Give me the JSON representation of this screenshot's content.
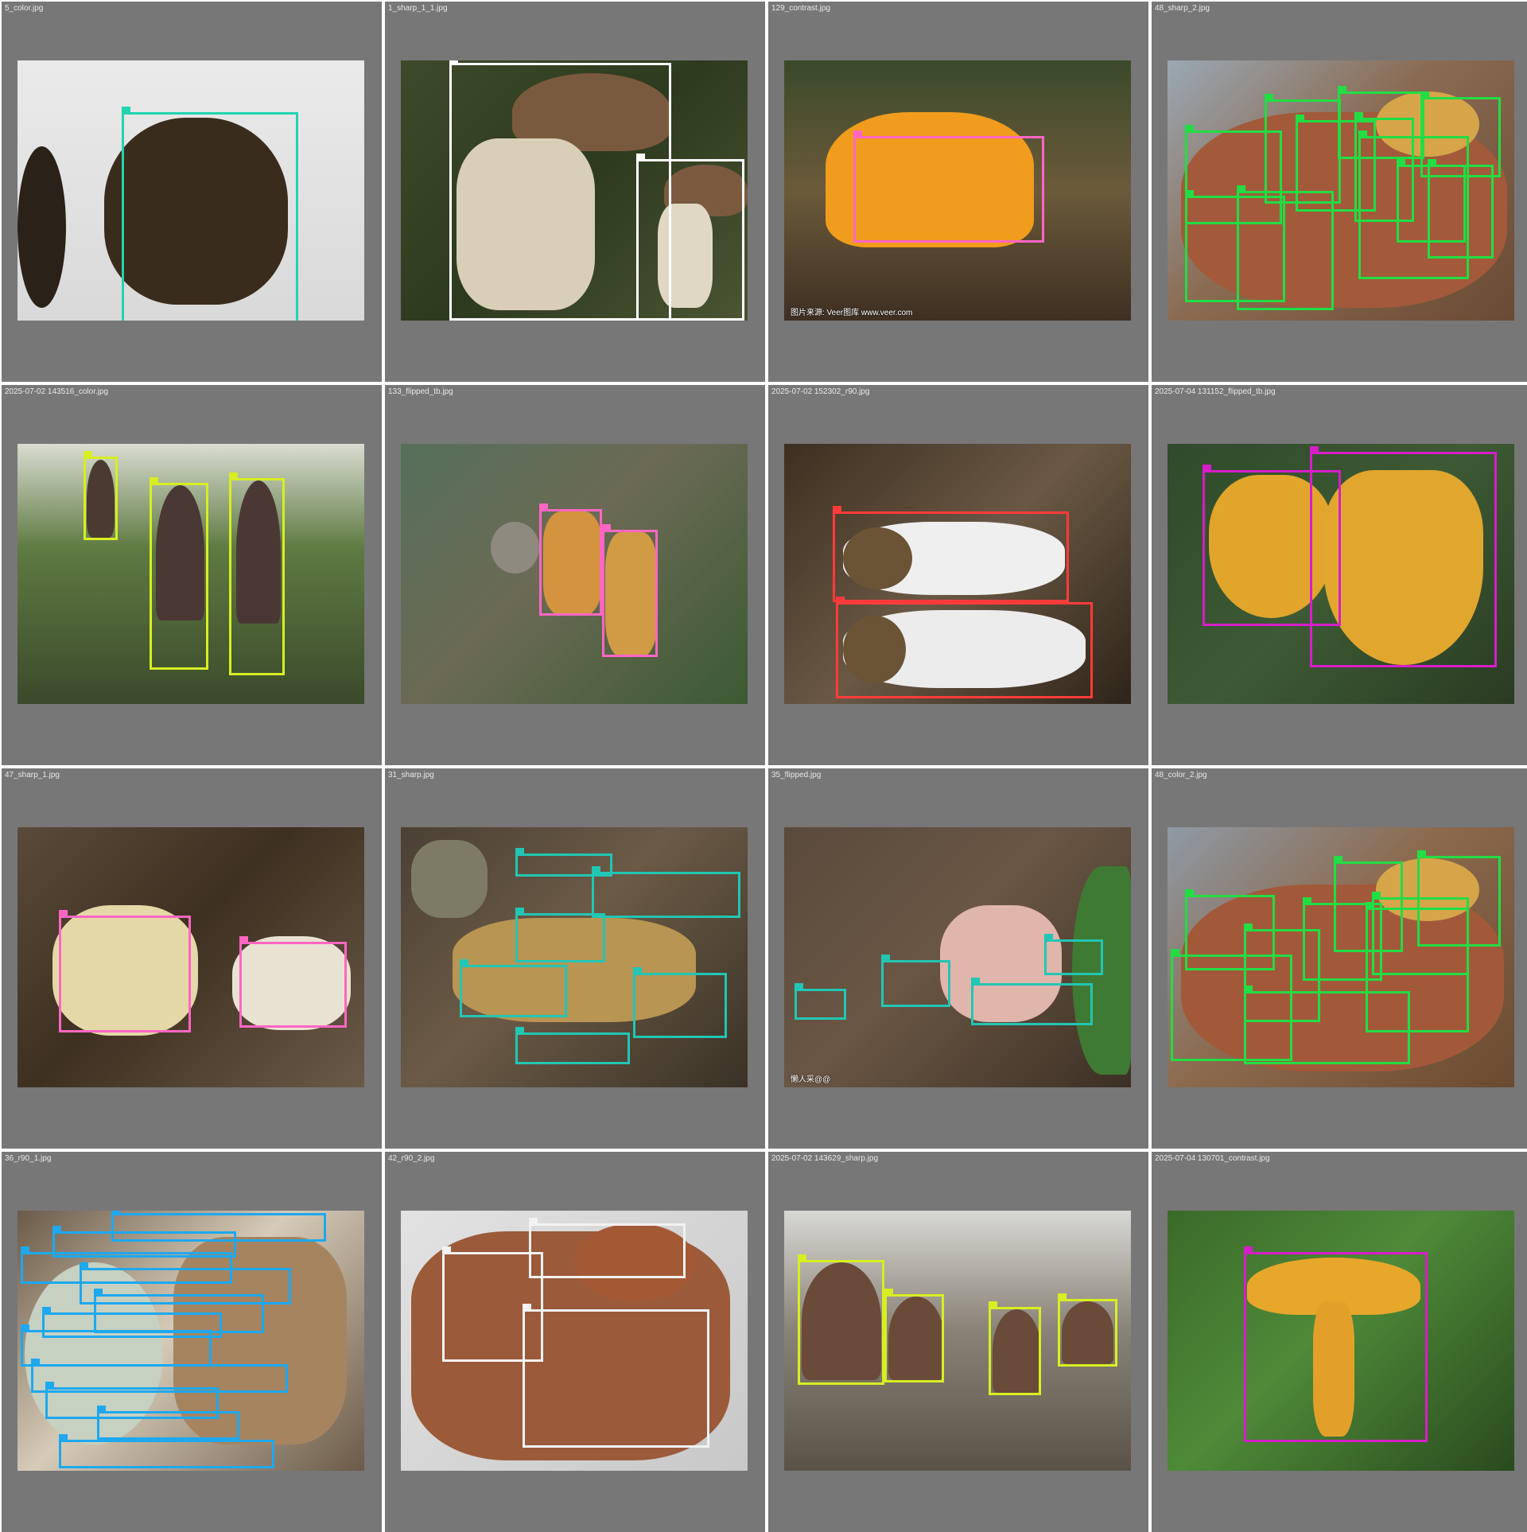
{
  "grid": {
    "cells": [
      {
        "filename": "5_color.jpg",
        "photo_bg": "linear-gradient(180deg,#eaeaea,#d9d9d9)",
        "box_color": "#22d3b0",
        "boxes": [
          [
            30,
            20,
            81,
            101
          ]
        ],
        "blobs": [
          {
            "l": 0,
            "t": 33,
            "w": 14,
            "h": 62,
            "c": "#2a2218",
            "r": "50%"
          },
          {
            "l": 25,
            "t": 22,
            "w": 53,
            "h": 72,
            "c": "#3a2c1c",
            "r": "45% 45% 40% 40%"
          }
        ]
      },
      {
        "filename": "1_sharp_1_1.jpg",
        "photo_bg": "linear-gradient(135deg,#3d4a2a,#2d3a1e 50%,#4b5533)",
        "box_color": "#ffffff",
        "boxes": [
          [
            14,
            1,
            78,
            100
          ],
          [
            68,
            38,
            99,
            100
          ]
        ],
        "blobs": [
          {
            "l": 32,
            "t": 5,
            "w": 46,
            "h": 30,
            "c": "#7a5a3e",
            "r": "50% 50% 30% 30%"
          },
          {
            "l": 16,
            "t": 30,
            "w": 40,
            "h": 66,
            "c": "#d8cfb6",
            "r": "30%"
          },
          {
            "l": 76,
            "t": 40,
            "w": 24,
            "h": 20,
            "c": "#7b5a40",
            "r": "50% 50% 30% 30%"
          },
          {
            "l": 74,
            "t": 55,
            "w": 16,
            "h": 40,
            "c": "#e0d8c4",
            "r": "30%"
          }
        ]
      },
      {
        "filename": "129_contrast.jpg",
        "photo_bg": "linear-gradient(180deg,#3a4a2a,#6b5a3a 50%,#3e2f22)",
        "box_color": "#ff66c4",
        "boxes": [
          [
            20,
            29,
            75,
            70
          ]
        ],
        "blobs": [
          {
            "l": 12,
            "t": 20,
            "w": 60,
            "h": 52,
            "c": "#f19c1d",
            "r": "40% 40% 20% 20%"
          }
        ],
        "watermark": "图片来源: Veer图库 www.veer.com"
      },
      {
        "filename": "48_sharp_2.jpg",
        "photo_bg": "linear-gradient(135deg,#9aa8b4,#8a6a50 45%,#6a4a34)",
        "box_color": "#22dd44",
        "boxes": [
          [
            5,
            27,
            33,
            63
          ],
          [
            28,
            15,
            50,
            55
          ],
          [
            49,
            12,
            74,
            38
          ],
          [
            73,
            14,
            96,
            45
          ],
          [
            37,
            23,
            60,
            58
          ],
          [
            20,
            50,
            48,
            96
          ],
          [
            54,
            22,
            71,
            62
          ],
          [
            55,
            29,
            87,
            84
          ],
          [
            75,
            40,
            94,
            76
          ],
          [
            5,
            52,
            34,
            93
          ],
          [
            66,
            40,
            86,
            70
          ]
        ],
        "blobs": [
          {
            "l": 4,
            "t": 20,
            "w": 94,
            "h": 75,
            "c": "#a25a3a",
            "r": "40%"
          },
          {
            "l": 60,
            "t": 12,
            "w": 30,
            "h": 25,
            "c": "#d6a54a",
            "r": "50%"
          }
        ]
      },
      {
        "filename": "2025-07-02 143516_color.jpg",
        "photo_bg": "linear-gradient(180deg,#d9ddd2,#5f7a42 40%,#3b4a2b)",
        "box_color": "#d7ee22",
        "boxes": [
          [
            19,
            5,
            29,
            37
          ],
          [
            38,
            15,
            55,
            87
          ],
          [
            61,
            13,
            77,
            89
          ]
        ],
        "blobs": [
          {
            "l": 20,
            "t": 6,
            "w": 8,
            "h": 30,
            "c": "#4a3a30",
            "r": "50% 50% 20% 20%"
          },
          {
            "l": 40,
            "t": 16,
            "w": 14,
            "h": 52,
            "c": "#4a3834",
            "r": "50% 50% 10% 10%"
          },
          {
            "l": 63,
            "t": 14,
            "w": 13,
            "h": 55,
            "c": "#4b3835",
            "r": "50% 50% 10% 10%"
          }
        ]
      },
      {
        "filename": "133_flipped_tb.jpg",
        "photo_bg": "linear-gradient(135deg,#56705a,#6b6a55 45%,#3b5a32)",
        "box_color": "#ff66c4",
        "boxes": [
          [
            40,
            25,
            58,
            66
          ],
          [
            58,
            33,
            74,
            82
          ]
        ],
        "blobs": [
          {
            "l": 41,
            "t": 26,
            "w": 17,
            "h": 40,
            "c": "#d3933f",
            "r": "30%"
          },
          {
            "l": 59,
            "t": 34,
            "w": 15,
            "h": 48,
            "c": "#d19a44",
            "r": "30%"
          },
          {
            "l": 26,
            "t": 30,
            "w": 14,
            "h": 20,
            "c": "#8f8a80",
            "r": "50%"
          }
        ]
      },
      {
        "filename": "2025-07-02 152302_r90.jpg",
        "photo_bg": "linear-gradient(135deg,#3d2f20,#6a5844 50%,#2e2418)",
        "box_color": "#ff3b3b",
        "boxes": [
          [
            14,
            26,
            82,
            61
          ],
          [
            15,
            61,
            89,
            98
          ]
        ],
        "blobs": [
          {
            "l": 17,
            "t": 30,
            "w": 64,
            "h": 28,
            "c": "#efefef",
            "r": "40%"
          },
          {
            "l": 17,
            "t": 64,
            "w": 70,
            "h": 30,
            "c": "#ececec",
            "r": "40%"
          },
          {
            "l": 17,
            "t": 32,
            "w": 20,
            "h": 24,
            "c": "#6b5335",
            "r": "50%"
          },
          {
            "l": 17,
            "t": 66,
            "w": 18,
            "h": 26,
            "c": "#6b5335",
            "r": "50%"
          }
        ]
      },
      {
        "filename": "2025-07-04 131152_flipped_tb.jpg",
        "photo_bg": "linear-gradient(135deg,#2e4a2a,#3d5a34 50%,#2a3b22)",
        "box_color": "#d61ec8",
        "boxes": [
          [
            10,
            10,
            50,
            70
          ],
          [
            41,
            3,
            95,
            86
          ]
        ],
        "blobs": [
          {
            "l": 12,
            "t": 12,
            "w": 36,
            "h": 55,
            "c": "#e2a52c",
            "r": "40% 40% 50% 50%"
          },
          {
            "l": 45,
            "t": 10,
            "w": 46,
            "h": 75,
            "c": "#e0a62e",
            "r": "35% 35% 55% 55%"
          }
        ]
      },
      {
        "filename": "47_sharp_1.jpg",
        "photo_bg": "linear-gradient(135deg,#5a4a3a,#3e3020 45%,#6a5a48)",
        "box_color": "#ff66c4",
        "boxes": [
          [
            12,
            34,
            50,
            79
          ],
          [
            64,
            44,
            95,
            77
          ]
        ],
        "blobs": [
          {
            "l": 10,
            "t": 30,
            "w": 42,
            "h": 50,
            "c": "#e4d8a8",
            "r": "40%"
          },
          {
            "l": 62,
            "t": 42,
            "w": 34,
            "h": 36,
            "c": "#e8e2d2",
            "r": "40%"
          }
        ]
      },
      {
        "filename": "31_sharp.jpg",
        "photo_bg": "linear-gradient(135deg,#4a4034,#6b5a46 45%,#3a3226)",
        "box_color": "#22c6b4",
        "boxes": [
          [
            33,
            10,
            61,
            19
          ],
          [
            55,
            17,
            98,
            35
          ],
          [
            33,
            33,
            59,
            52
          ],
          [
            17,
            53,
            48,
            73
          ],
          [
            67,
            56,
            94,
            81
          ],
          [
            33,
            79,
            66,
            91
          ]
        ],
        "blobs": [
          {
            "l": 15,
            "t": 35,
            "w": 70,
            "h": 40,
            "c": "#b89552",
            "r": "35%"
          },
          {
            "l": 3,
            "t": 5,
            "w": 22,
            "h": 30,
            "c": "#7d7a66",
            "r": "40%"
          }
        ]
      },
      {
        "filename": "35_flipped.jpg",
        "photo_bg": "linear-gradient(135deg,#5a4a3c,#6a5644 45%,#3c3024)",
        "box_color": "#22c6b4",
        "boxes": [
          [
            3,
            62,
            18,
            74
          ],
          [
            28,
            51,
            48,
            69
          ],
          [
            54,
            60,
            89,
            76
          ],
          [
            75,
            43,
            92,
            57
          ]
        ],
        "blobs": [
          {
            "l": 45,
            "t": 30,
            "w": 35,
            "h": 45,
            "c": "#e0b5ac",
            "r": "40%"
          },
          {
            "l": 83,
            "t": 15,
            "w": 17,
            "h": 80,
            "c": "#3f7a34",
            "r": "50% 10% 10% 50%"
          }
        ],
        "watermark": "懒人采@@"
      },
      {
        "filename": "48_color_2.jpg",
        "photo_bg": "linear-gradient(135deg,#8e9aa6,#8c6a4e 45%,#6a4a30)",
        "box_color": "#22dd44",
        "boxes": [
          [
            5,
            26,
            31,
            55
          ],
          [
            72,
            11,
            96,
            46
          ],
          [
            48,
            13,
            68,
            48
          ],
          [
            39,
            29,
            62,
            59
          ],
          [
            59,
            27,
            87,
            57
          ],
          [
            22,
            39,
            44,
            75
          ],
          [
            1,
            49,
            36,
            90
          ],
          [
            57,
            31,
            87,
            79
          ],
          [
            22,
            63,
            70,
            91
          ]
        ],
        "blobs": [
          {
            "l": 4,
            "t": 22,
            "w": 93,
            "h": 72,
            "c": "#a2593a",
            "r": "40%"
          },
          {
            "l": 60,
            "t": 12,
            "w": 30,
            "h": 24,
            "c": "#d6a54a",
            "r": "50%"
          }
        ]
      },
      {
        "filename": "36_r90_1.jpg",
        "photo_bg": "linear-gradient(135deg,#6b5a48,#d6cbb8 45%,#6b5a48)",
        "box_color": "#1ea8ee",
        "boxes": [
          [
            27,
            1,
            89,
            12
          ],
          [
            10,
            8,
            63,
            18
          ],
          [
            1,
            16,
            62,
            28
          ],
          [
            18,
            22,
            79,
            36
          ],
          [
            22,
            32,
            71,
            47
          ],
          [
            7,
            39,
            59,
            49
          ],
          [
            1,
            46,
            56,
            60
          ],
          [
            4,
            59,
            78,
            70
          ],
          [
            8,
            68,
            58,
            80
          ],
          [
            23,
            77,
            64,
            88
          ],
          [
            12,
            88,
            74,
            99
          ]
        ],
        "blobs": [
          {
            "l": 2,
            "t": 20,
            "w": 40,
            "h": 70,
            "c": "#c7d1c2",
            "r": "50%"
          },
          {
            "l": 45,
            "t": 10,
            "w": 50,
            "h": 80,
            "c": "#a68460",
            "r": "30%"
          }
        ],
        "watermark": ""
      },
      {
        "filename": "42_r90_2.jpg",
        "photo_bg": "linear-gradient(135deg,#e2e2e2,#c8c8c8)",
        "box_color": "#f2f2f2",
        "boxes": [
          [
            37,
            5,
            82,
            26
          ],
          [
            12,
            16,
            41,
            58
          ],
          [
            35,
            38,
            89,
            91
          ]
        ],
        "blobs": [
          {
            "l": 3,
            "t": 8,
            "w": 92,
            "h": 88,
            "c": "#9b5a3a",
            "r": "30%"
          },
          {
            "l": 50,
            "t": 5,
            "w": 35,
            "h": 30,
            "c": "#a35a34",
            "r": "50%"
          }
        ]
      },
      {
        "filename": "2025-07-02 143629_sharp.jpg",
        "photo_bg": "linear-gradient(180deg,#d8d8d4,#8a8478 45%,#5a5246)",
        "box_color": "#d7ee22",
        "boxes": [
          [
            4,
            19,
            29,
            67
          ],
          [
            29,
            32,
            46,
            66
          ],
          [
            59,
            37,
            74,
            71
          ],
          [
            79,
            34,
            96,
            60
          ]
        ],
        "blobs": [
          {
            "l": 5,
            "t": 20,
            "w": 23,
            "h": 45,
            "c": "#6a4a38",
            "r": "50% 50% 10% 10%"
          },
          {
            "l": 30,
            "t": 33,
            "w": 16,
            "h": 32,
            "c": "#6a4a38",
            "r": "50% 50% 10% 10%"
          },
          {
            "l": 60,
            "t": 38,
            "w": 14,
            "h": 32,
            "c": "#6a4a38",
            "r": "50% 50% 10% 10%"
          },
          {
            "l": 80,
            "t": 35,
            "w": 15,
            "h": 24,
            "c": "#6a4a38",
            "r": "50% 50% 10% 10%"
          }
        ]
      },
      {
        "filename": "2025-07-04 130701_contrast.jpg",
        "photo_bg": "linear-gradient(135deg,#3b6a2a,#4e8a38 45%,#2a4a1e)",
        "box_color": "#d61ec8",
        "boxes": [
          [
            22,
            16,
            75,
            89
          ]
        ],
        "blobs": [
          {
            "l": 23,
            "t": 18,
            "w": 50,
            "h": 22,
            "c": "#e6a72a",
            "r": "50% 50% 30% 30%"
          },
          {
            "l": 42,
            "t": 35,
            "w": 12,
            "h": 52,
            "c": "#e2a02a",
            "r": "30%"
          }
        ]
      }
    ]
  }
}
